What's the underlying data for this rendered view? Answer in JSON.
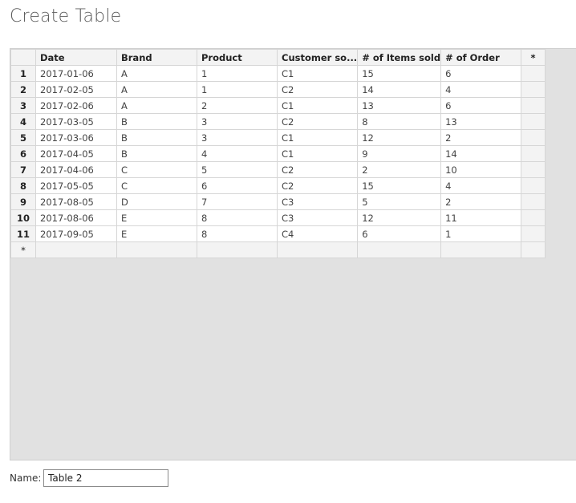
{
  "dialog": {
    "title": "Create Table"
  },
  "table": {
    "columns": [
      "Date",
      "Brand",
      "Product",
      "Customer so...",
      "# of Items sold",
      "# of Order"
    ],
    "add_column_label": "*",
    "add_row_label": "*",
    "rows": [
      {
        "num": "1",
        "cells": [
          "2017-01-06",
          "A",
          "1",
          "C1",
          "15",
          "6"
        ]
      },
      {
        "num": "2",
        "cells": [
          "2017-02-05",
          "A",
          "1",
          "C2",
          "14",
          "4"
        ]
      },
      {
        "num": "3",
        "cells": [
          "2017-02-06",
          "A",
          "2",
          "C1",
          "13",
          "6"
        ]
      },
      {
        "num": "4",
        "cells": [
          "2017-03-05",
          "B",
          "3",
          "C2",
          "8",
          "13"
        ]
      },
      {
        "num": "5",
        "cells": [
          "2017-03-06",
          "B",
          "3",
          "C1",
          "12",
          "2"
        ]
      },
      {
        "num": "6",
        "cells": [
          "2017-04-05",
          "B",
          "4",
          "C1",
          "9",
          "14"
        ]
      },
      {
        "num": "7",
        "cells": [
          "2017-04-06",
          "C",
          "5",
          "C2",
          "2",
          "10"
        ]
      },
      {
        "num": "8",
        "cells": [
          "2017-05-05",
          "C",
          "6",
          "C2",
          "15",
          "4"
        ]
      },
      {
        "num": "9",
        "cells": [
          "2017-08-05",
          "D",
          "7",
          "C3",
          "5",
          "2"
        ]
      },
      {
        "num": "10",
        "cells": [
          "2017-08-06",
          "E",
          "8",
          "C3",
          "12",
          "11"
        ]
      },
      {
        "num": "11",
        "cells": [
          "2017-09-05",
          "E",
          "8",
          "C4",
          "6",
          "1"
        ]
      }
    ]
  },
  "name_field": {
    "label": "Name:",
    "value": "Table 2"
  }
}
